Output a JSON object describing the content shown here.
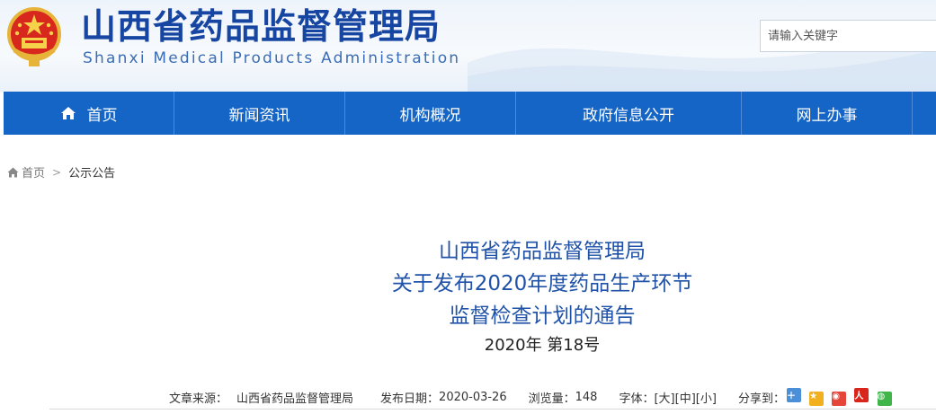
{
  "header": {
    "title": "山西省药品监督管理局",
    "subtitle": "Shanxi Medical Products Administration",
    "search_placeholder": "请输入关键字"
  },
  "nav": {
    "items": [
      {
        "label": "首页",
        "icon": "home-icon"
      },
      {
        "label": "新闻资讯"
      },
      {
        "label": "机构概况"
      },
      {
        "label": "政府信息公开"
      },
      {
        "label": "网上办事"
      }
    ]
  },
  "breadcrumb": {
    "home": "首页",
    "separator": ">",
    "current": "公示公告"
  },
  "article": {
    "title_line1": "山西省药品监督管理局",
    "title_line2": "关于发布2020年度药品生产环节",
    "title_line3": "监督检查计划的通告",
    "number": "2020年 第18号"
  },
  "meta": {
    "source_label": "文章来源：",
    "source_value": "山西省药品监督管理局",
    "date_label": "发布日期：",
    "date_value": "2020-03-26",
    "views_label": "浏览量：",
    "views_value": "148",
    "font_label": "字体：",
    "font_large": "[大]",
    "font_medium": "[中]",
    "font_small": "[小]",
    "share_label": "分享到："
  },
  "colors": {
    "brand_blue": "#1565c6",
    "title_blue": "#1746a2",
    "article_blue": "#1f52a8"
  }
}
